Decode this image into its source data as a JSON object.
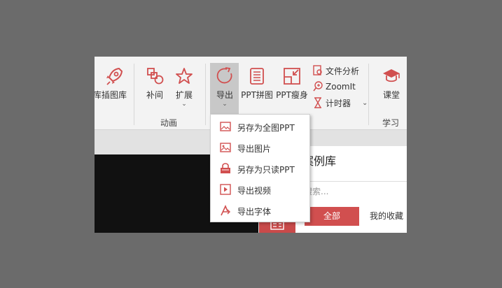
{
  "ribbon": {
    "partial_left": "库",
    "buttons": {
      "insert_lib": "插图库",
      "tween": "补间",
      "extend": "扩展",
      "export": "导出",
      "ppt_collage": "PPT拼图",
      "ppt_slim": "PPT瘦身",
      "learn": "课堂"
    },
    "small_buttons": {
      "file_analysis": "文件分析",
      "zoomit": "ZoomIt",
      "timer": "计时器"
    },
    "groups": {
      "animation": "动画",
      "study": "学习"
    },
    "caret": "⌄"
  },
  "panel": {
    "title": "案例库",
    "search_placeholder": "搜索...",
    "tab_all": "全部",
    "tab_fav": "我的收藏"
  },
  "dropdown": {
    "items": [
      {
        "label": "另存为全图PPT",
        "icon": "image-ppt-icon"
      },
      {
        "label": "导出图片",
        "icon": "image-icon"
      },
      {
        "label": "另存为只读PPT",
        "icon": "lock-icon"
      },
      {
        "label": "导出视频",
        "icon": "video-icon"
      },
      {
        "label": "导出字体",
        "icon": "font-icon"
      }
    ]
  },
  "colors": {
    "accent": "#d14f4f",
    "ribbon_bg": "#f3f3f3",
    "backdrop": "#6b6b6b"
  }
}
